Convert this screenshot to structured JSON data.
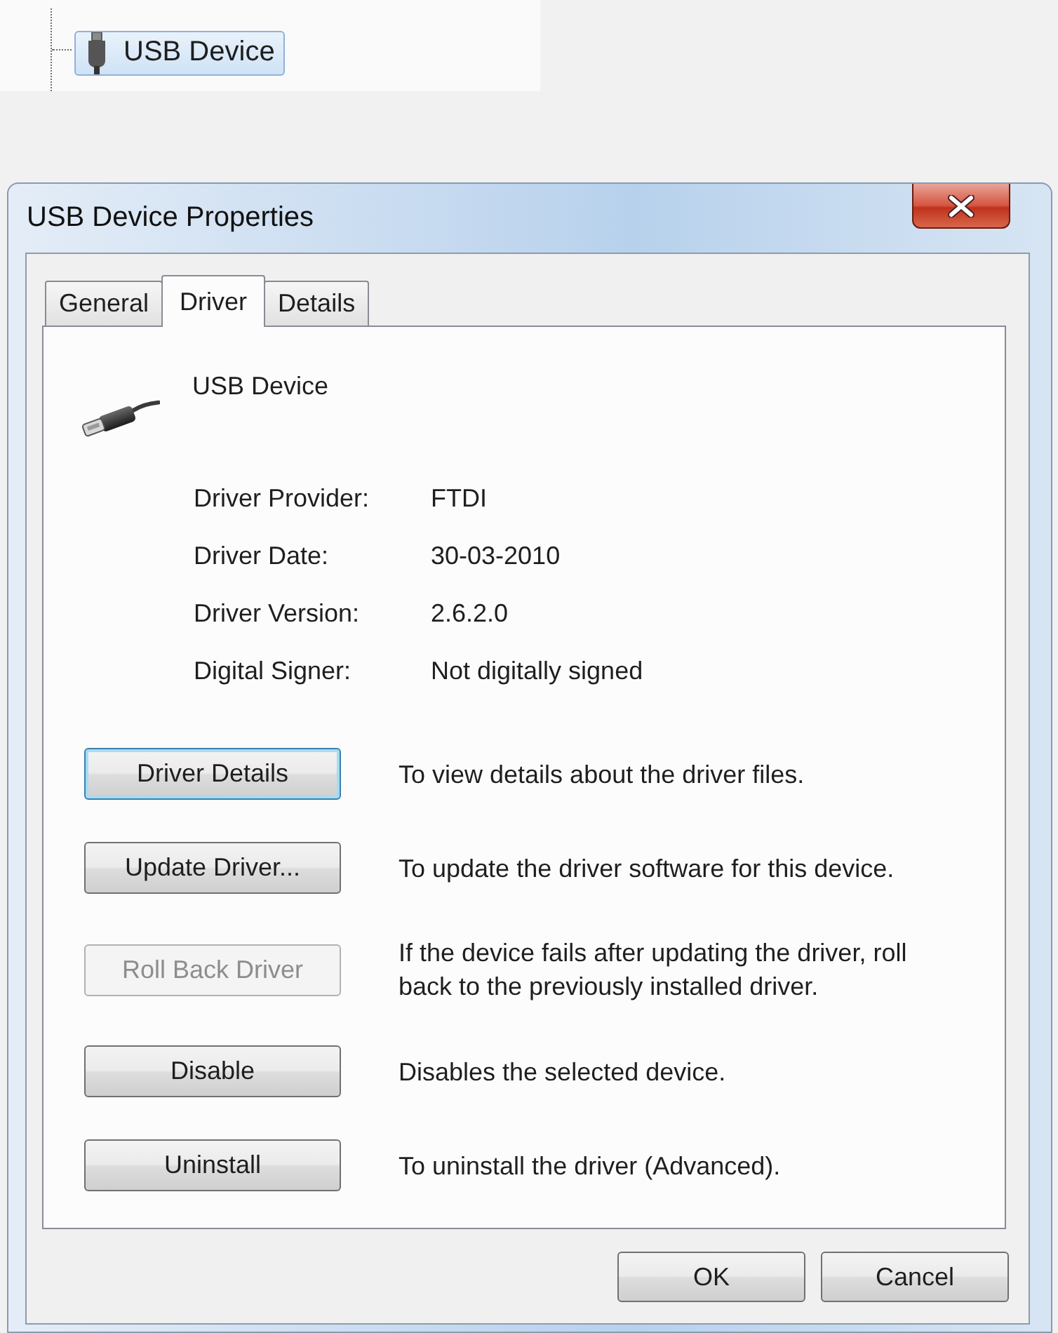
{
  "device_tree": {
    "items": [
      {
        "label": "USB Device",
        "selected": true
      }
    ]
  },
  "window": {
    "title": "USB Device Properties"
  },
  "tabs": [
    {
      "label": "General",
      "selected": false
    },
    {
      "label": "Driver",
      "selected": true
    },
    {
      "label": "Details",
      "selected": false
    }
  ],
  "device": {
    "name": "USB Device"
  },
  "properties": [
    {
      "label": "Driver Provider:",
      "value": "FTDI"
    },
    {
      "label": "Driver Date:",
      "value": "30-03-2010"
    },
    {
      "label": "Driver Version:",
      "value": "2.6.2.0"
    },
    {
      "label": "Digital Signer:",
      "value": "Not digitally signed"
    }
  ],
  "actions": [
    {
      "button": "Driver Details",
      "focused": true,
      "disabled": false,
      "description": "To view details about the driver files."
    },
    {
      "button": "Update Driver...",
      "focused": false,
      "disabled": false,
      "description": "To update the driver software for this device."
    },
    {
      "button": "Roll Back Driver",
      "focused": false,
      "disabled": true,
      "description": "If the device fails after updating the driver, roll back to the previously installed driver."
    },
    {
      "button": "Disable",
      "focused": false,
      "disabled": false,
      "description": "Disables the selected device."
    },
    {
      "button": "Uninstall",
      "focused": false,
      "disabled": false,
      "description": "To uninstall the driver (Advanced)."
    }
  ],
  "buttons": [
    {
      "label": "OK"
    },
    {
      "label": "Cancel"
    }
  ]
}
